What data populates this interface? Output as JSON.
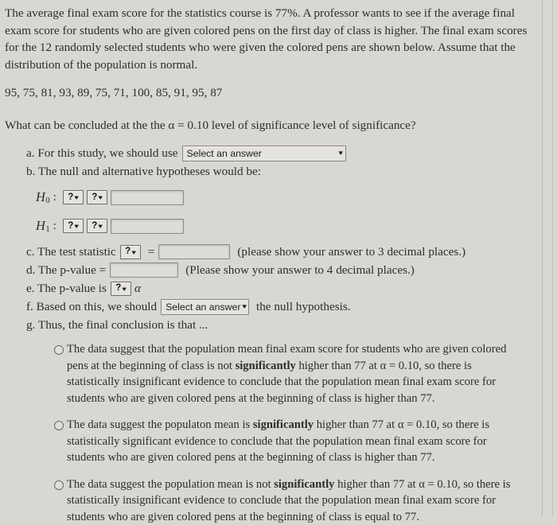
{
  "prompt": {
    "paragraph": "The average final exam score for the statistics course is 77%. A professor wants to see if the average final exam score for students who are given colored pens on the first day of class is higher. The final exam scores for the 12 randomly selected students who were given the colored pens are shown below. Assume that the distribution of the population is normal.",
    "data_values": "95, 75, 81, 93, 89, 75, 71, 100, 85, 91, 95, 87",
    "question": "What can be concluded at the the α = 0.10 level of significance level of significance?"
  },
  "items": {
    "a": {
      "label": "a. For this study, we should use",
      "select_value": "Select an answer"
    },
    "b": {
      "label": "b. The null and alternative hypotheses would be:",
      "h0_name": "H",
      "h0_sub": "0",
      "h1_name": "H",
      "h1_sub": "1",
      "colon": ":",
      "qmark": "?",
      "chevron": "▾",
      "input_value": ""
    },
    "c": {
      "label": "c. The test statistic",
      "qmark": "?",
      "equals": "=",
      "input_value": "",
      "hint": "(please show your answer to 3 decimal places.)"
    },
    "d": {
      "label": "d. The p-value =",
      "input_value": "",
      "hint": "(Please show your answer to 4 decimal places.)"
    },
    "e": {
      "label": "e. The p-value is",
      "qmark": "?",
      "alpha": "α"
    },
    "f": {
      "label": "f. Based on this, we should",
      "select_value": "Select an answer",
      "suffix": "the null hypothesis."
    },
    "g": {
      "label": "g. Thus, the final conclusion is that ..."
    }
  },
  "conclusion_options": [
    {
      "pre": "The data suggest that the population mean final exam score for students who are given colored pens at the beginning of class is not ",
      "bold": "significantly",
      "post": " higher than 77 at α = 0.10, so there is statistically insignificant evidence to conclude that the population mean final exam score for students who are given colored pens at the beginning of class is higher than 77.",
      "selected": false
    },
    {
      "pre": "The data suggest the populaton mean is ",
      "bold": "significantly",
      "post": " higher than 77 at α = 0.10, so there is statistically significant evidence to conclude that the population mean final exam score for students who are given colored pens at the beginning of class is higher than 77.",
      "selected": false
    },
    {
      "pre": "The data suggest the population mean is not ",
      "bold": "significantly",
      "post": " higher than 77 at α = 0.10, so there is statistically insignificant evidence to conclude that the population mean final exam score for students who are given colored pens at the beginning of class is equal to 77.",
      "selected": false
    }
  ]
}
